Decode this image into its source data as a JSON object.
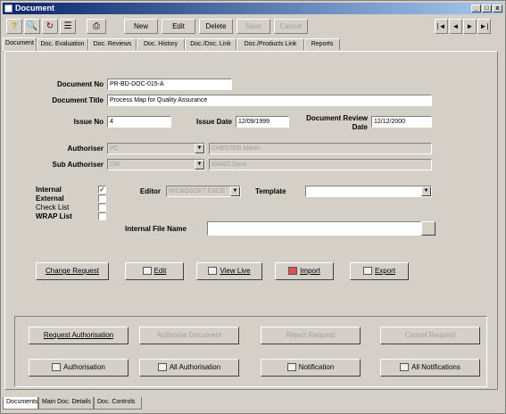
{
  "window": {
    "title": "Document",
    "min": "_",
    "max": "□",
    "close": "x"
  },
  "toolbar": {
    "icons": [
      "help-icon",
      "search-icon",
      "refresh-icon",
      "list-icon",
      "print-icon"
    ],
    "buttons": [
      {
        "label": "New",
        "enabled": true
      },
      {
        "label": "Edit",
        "enabled": true
      },
      {
        "label": "Delete",
        "enabled": true
      },
      {
        "label": "Save",
        "enabled": false
      },
      {
        "label": "Cancel",
        "enabled": false
      }
    ],
    "nav": [
      "|◄",
      "◄",
      "►",
      "►|"
    ]
  },
  "tabs": [
    "Document",
    "Doc. Evaluation",
    "Doc. Reviews",
    "Doc. History",
    "Doc./Doc. Link",
    "Doc./Products Link",
    "Reports"
  ],
  "form": {
    "document_no_label": "Document No",
    "document_no": "PR-BD-DOC-015-A",
    "document_title_label": "Document Title",
    "document_title": "Process Map for Quality Assurance",
    "issue_no_label": "Issue No",
    "issue_no": "4",
    "issue_date_label": "Issue Date",
    "issue_date": "12/09/1999",
    "review_date_label": "Document Review Date",
    "review_date": "12/12/2000",
    "authoriser_label": "Authoriser",
    "authoriser_code": "PC",
    "authoriser_name": "CHESTER Martin",
    "sub_authoriser_label": "Sub Authoriser",
    "sub_authoriser_code": "DW",
    "sub_authoriser_name": "WARD Dave",
    "internal_label": "Internal",
    "internal_checked": "✓",
    "external_label": "External",
    "check_list_label": "Check List",
    "wrap_list_label": "WRAP List",
    "editor_label": "Editor",
    "editor_value": "MICROSOFT EXCE",
    "template_label": "Template",
    "template_value": "",
    "internal_file_label": "Internal File Name",
    "internal_file_value": ""
  },
  "actions": [
    {
      "label": "Change Request"
    },
    {
      "label": "Edit"
    },
    {
      "label": "View Live"
    },
    {
      "label": "Import"
    },
    {
      "label": "Export"
    }
  ],
  "workflow_row1": [
    {
      "label": "Request Authorisation",
      "enabled": true
    },
    {
      "label": "Authorise Document",
      "enabled": false
    },
    {
      "label": "Reject Request",
      "enabled": false
    },
    {
      "label": "Cancel Request",
      "enabled": false
    }
  ],
  "workflow_row2": [
    {
      "label": "Authorisation",
      "enabled": true
    },
    {
      "label": "All Authorisation",
      "enabled": true
    },
    {
      "label": "Notification",
      "enabled": true
    },
    {
      "label": "All Notifications",
      "enabled": true
    }
  ],
  "bottom_tabs": [
    "Documents",
    "Main Doc. Details",
    "Doc. Controls"
  ]
}
